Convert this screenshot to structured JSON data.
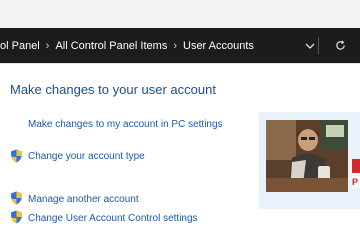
{
  "address_bar": {
    "breadcrumbs": [
      "ol Panel",
      "All Control Panel Items",
      "User Accounts"
    ]
  },
  "main": {
    "title": "Make changes to your user account",
    "links": {
      "pc_settings": "Make changes to my account in PC settings",
      "change_type": "Change your account type",
      "manage_another": "Manage another account",
      "uac_settings": "Change User Account Control settings"
    }
  },
  "side_panel": {
    "badge_partial": "P"
  },
  "icons": {
    "chevron": "chevron-down-icon",
    "refresh": "refresh-icon",
    "shield": "uac-shield-icon"
  },
  "colors": {
    "title": "#1e4e8c",
    "link": "#1a5aa8",
    "address_bar_bg": "#1c1c1c",
    "side_panel_bg": "#eaf3fb"
  }
}
